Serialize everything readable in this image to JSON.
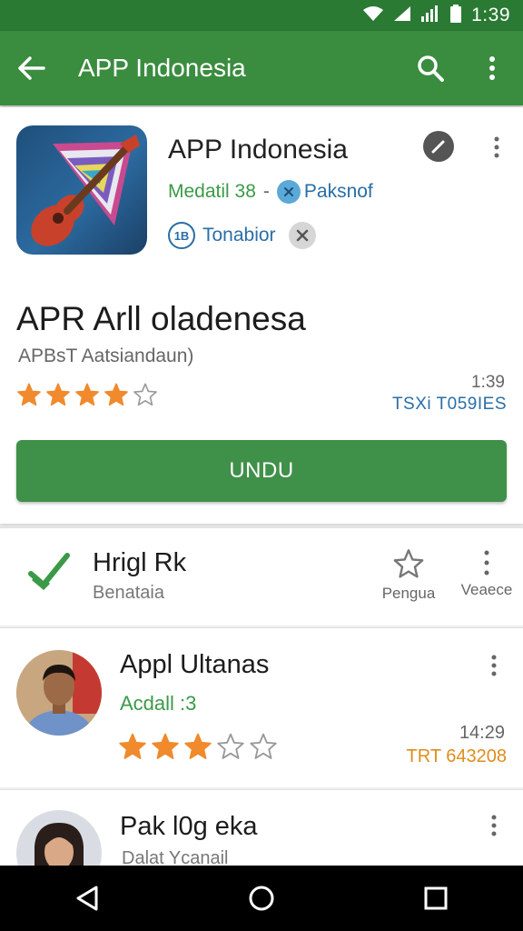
{
  "status_bar": {
    "clock": "1:39"
  },
  "app_bar": {
    "title": "APP Indonesia"
  },
  "app_card": {
    "name": "APP Indonesia",
    "meta_green": "Medatil 38",
    "meta_dash": "-",
    "meta_blue": "Paksnof",
    "badge_text": "1B",
    "badge_label": "Tonabior",
    "headline": "APR Arll oladenesa",
    "subline": "APBsT Aatsiandaun)",
    "rating_stars": 4,
    "rating_max": 5,
    "time": "1:39",
    "code": "TSXi T059IES",
    "install_label": "UNDU"
  },
  "list": {
    "row1": {
      "title": "Hrigl Rk",
      "sub": "Benataia",
      "action1_label": "Pengua",
      "action2_label": "Veaece"
    },
    "row2": {
      "title": "Appl Ultanas",
      "green": "Acdall :3",
      "rating_stars": 3,
      "rating_max": 5,
      "time": "14:29",
      "code": "TRT 643208"
    },
    "row3": {
      "title": "Pak l0g eka",
      "sub": "Dalat Ycanail"
    }
  },
  "colors": {
    "status_bar": "#2a7a34",
    "app_bar": "#3a8c3f",
    "install_button": "#3f9048",
    "star_filled": "#f08a2c",
    "accent_blue": "#2a6ea6",
    "accent_green": "#3b9a47"
  },
  "icons": {
    "back": "arrow-left-icon",
    "search": "search-icon",
    "overflow": "more-vert-icon",
    "edit": "edit-icon",
    "check": "check-icon",
    "star_outline": "star-outline-icon"
  }
}
